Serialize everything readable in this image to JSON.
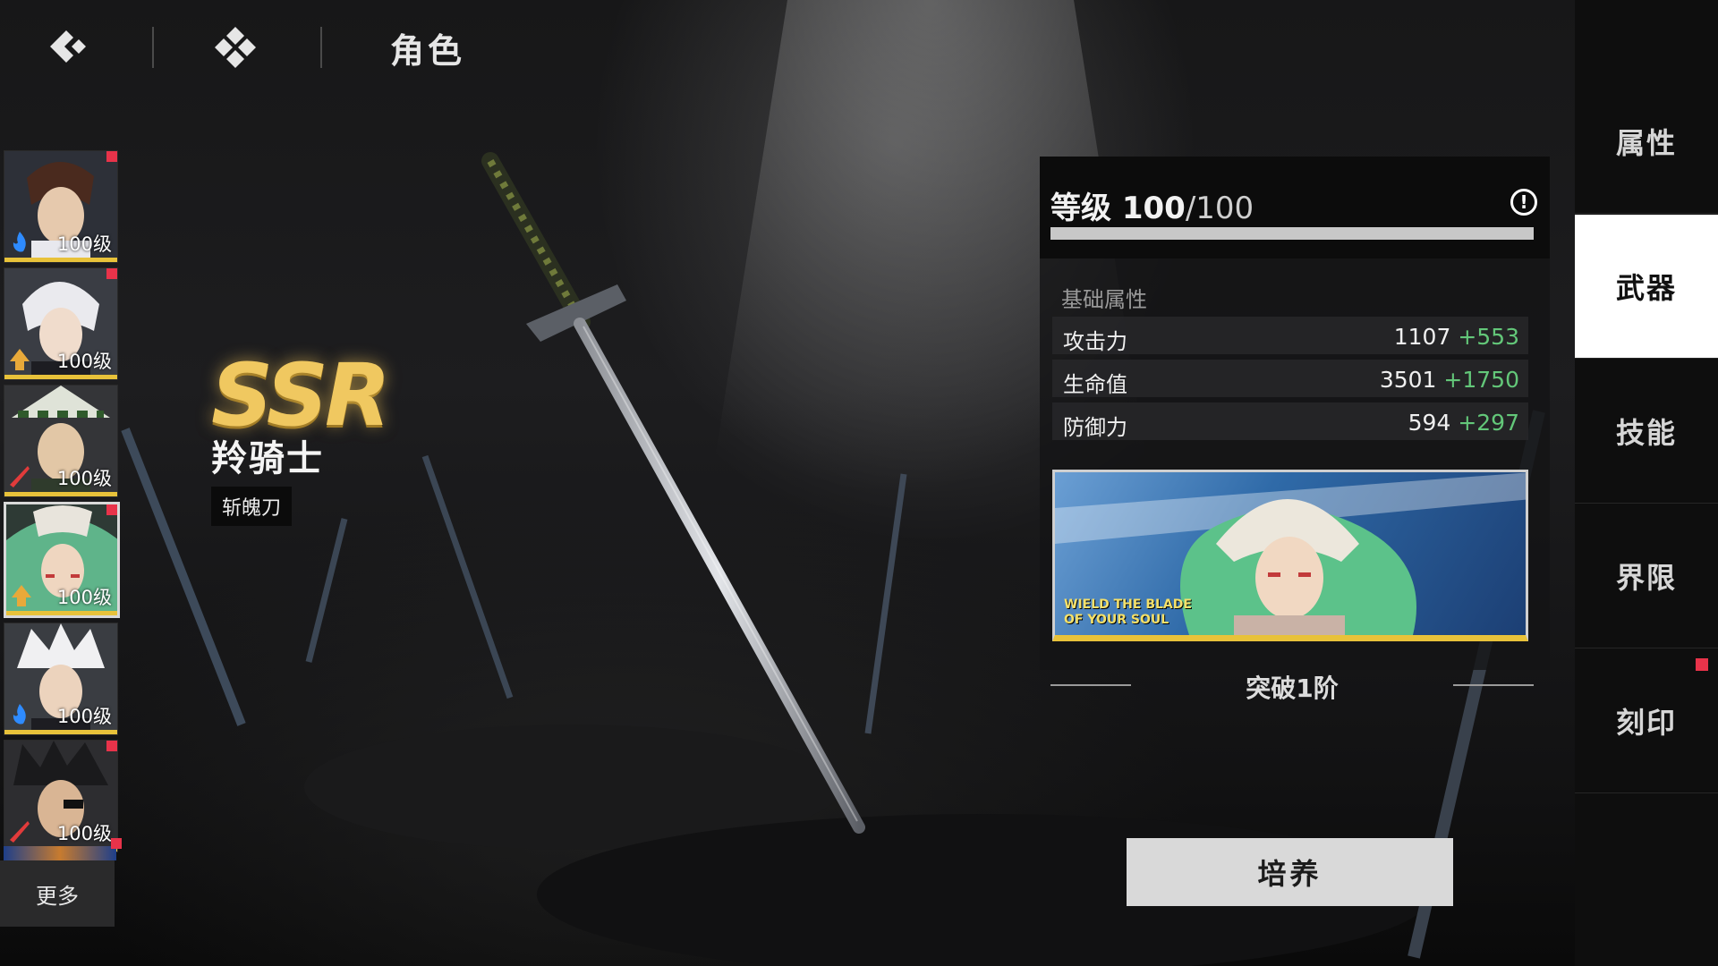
{
  "topbar": {
    "back_icon": "back-chevron-icon",
    "home_icon": "diamond-menu-icon",
    "title": "角色"
  },
  "roster": {
    "characters": [
      {
        "level": "100级",
        "element": "blue-flame",
        "badge": true
      },
      {
        "level": "100级",
        "element": "gold-arrow",
        "badge": true
      },
      {
        "level": "100级",
        "element": "red-slash",
        "badge": false
      },
      {
        "level": "100级",
        "element": "gold-arrow",
        "badge": true,
        "selected": true
      },
      {
        "level": "100级",
        "element": "blue-flame",
        "badge": false
      },
      {
        "level": "100级",
        "element": "red-slash",
        "badge": true
      }
    ],
    "more_label": "更多"
  },
  "weapon": {
    "rarity": "SSR",
    "name": "羚骑士",
    "type": "斩魄刀"
  },
  "level_panel": {
    "label": "等级",
    "current": "100",
    "max": "/100",
    "progress": 1.0
  },
  "attributes": {
    "title": "基础属性",
    "stats": [
      {
        "name": "攻击力",
        "base": "1107",
        "bonus": "+553"
      },
      {
        "name": "生命值",
        "base": "3501",
        "bonus": "+1750"
      },
      {
        "name": "防御力",
        "base": "594",
        "bonus": "+297"
      }
    ]
  },
  "banner": {
    "tagline_1": "WIELD THE BLADE",
    "tagline_2": "OF YOUR SOUL"
  },
  "breakthrough": "突破1阶",
  "train_button": "培养",
  "tabs": [
    {
      "label": "属性"
    },
    {
      "label": "武器",
      "active": true
    },
    {
      "label": "技能"
    },
    {
      "label": "界限"
    },
    {
      "label": "刻印",
      "badge": true
    }
  ],
  "colors": {
    "accent_gold": "#e8c23a",
    "bonus_green": "#63c779",
    "badge_red": "#e8334a"
  }
}
